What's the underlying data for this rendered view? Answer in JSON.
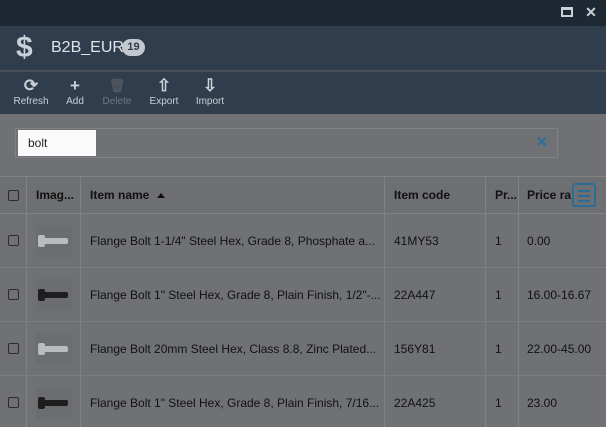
{
  "window": {
    "maximize_icon": "maximize-icon",
    "close_icon": "close-icon",
    "close_glyph": "✕"
  },
  "header": {
    "icon": "dollar-icon",
    "icon_glyph": "$",
    "title": "B2B_EUR",
    "count": "19"
  },
  "toolbar": {
    "items": [
      {
        "label": "Refresh",
        "icon": "refresh-icon",
        "glyph": "⟳",
        "enabled": true
      },
      {
        "label": "Add",
        "icon": "plus-icon",
        "glyph": "+",
        "enabled": true
      },
      {
        "label": "Delete",
        "icon": "trash-icon",
        "glyph": "🗑",
        "enabled": false
      },
      {
        "label": "Export",
        "icon": "upload-icon",
        "glyph": "⇧",
        "enabled": true
      },
      {
        "label": "Import",
        "icon": "download-icon",
        "glyph": "⇩",
        "enabled": true
      }
    ]
  },
  "search": {
    "value": "bolt",
    "placeholder": "",
    "clear_icon": "clear-icon",
    "clear_glyph": "✕"
  },
  "grid": {
    "columns": [
      {
        "key": "select",
        "label": ""
      },
      {
        "key": "image",
        "label": "Imag..."
      },
      {
        "key": "item_name",
        "label": "Item name",
        "sorted": "asc"
      },
      {
        "key": "item_code",
        "label": "Item code"
      },
      {
        "key": "pr",
        "label": "Pr..."
      },
      {
        "key": "price_range",
        "label": "Price ra"
      }
    ],
    "rows": [
      {
        "image": "zinc-bolt-thumbnail",
        "item_name": "Flange Bolt 1-1/4\" Steel Hex, Grade 8, Phosphate a...",
        "item_code": "41MY53",
        "pr": "1",
        "price_range": "0.00"
      },
      {
        "image": "black-bolt-thumbnail",
        "item_name": "Flange Bolt 1\" Steel Hex, Grade 8, Plain Finish, 1/2\"-...",
        "item_code": "22A447",
        "pr": "1",
        "price_range": "16.00-16.67"
      },
      {
        "image": "zinc-bolt-thumbnail",
        "item_name": "Flange Bolt 20mm Steel Hex, Class 8.8, Zinc Plated...",
        "item_code": "156Y81",
        "pr": "1",
        "price_range": "22.00-45.00"
      },
      {
        "image": "black-bolt-thumbnail",
        "item_name": "Flange Bolt 1\" Steel Hex, Grade 8, Plain Finish, 7/16...",
        "item_code": "22A425",
        "pr": "1",
        "price_range": "23.00"
      }
    ],
    "column_menu_icon": "column-menu-icon"
  },
  "colors": {
    "titlebar": "#1e2833",
    "header": "#2f3d4c",
    "accent": "#2a6d98",
    "overlay": "#6f7174"
  }
}
